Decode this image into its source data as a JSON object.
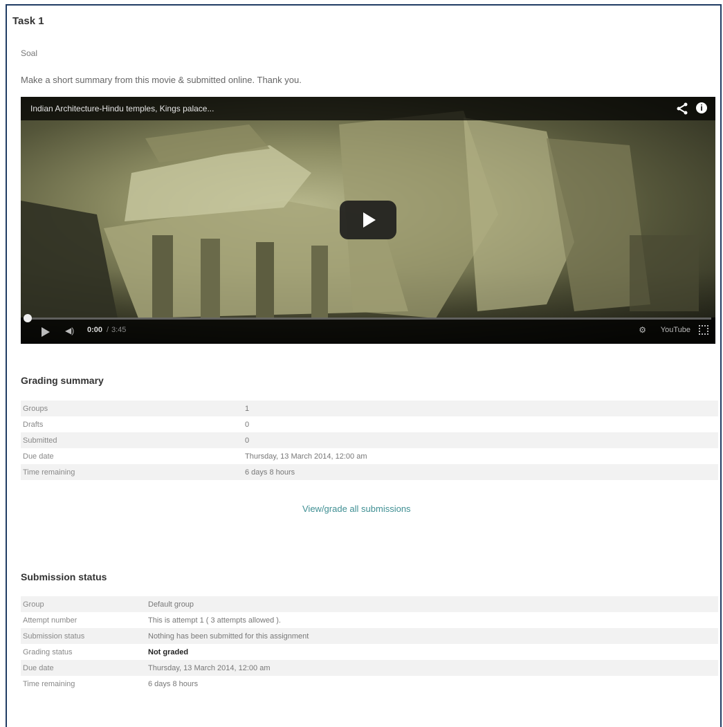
{
  "task": {
    "title": "Task 1",
    "soal": "Soal",
    "intro": "Make a short summary from this movie & submitted online. Thank you."
  },
  "video": {
    "title": "Indian Architecture-Hindu temples, Kings palace...",
    "current_time": "0:00",
    "separator": "/",
    "total_time": "3:45",
    "progress_fraction": 0.0,
    "share_icon": "share-icon",
    "info_icon": "info-icon",
    "info_glyph": "i",
    "volume_glyph": "◀)",
    "settings_glyph": "⚙",
    "youtube_label": "YouTube"
  },
  "grading_summary": {
    "title": "Grading summary",
    "rows": [
      {
        "label": "Groups",
        "value": "1"
      },
      {
        "label": "Drafts",
        "value": "0"
      },
      {
        "label": "Submitted",
        "value": "0"
      },
      {
        "label": "Due date",
        "value": "Thursday, 13 March 2014, 12:00 am"
      },
      {
        "label": "Time remaining",
        "value": "6 days 8 hours"
      }
    ],
    "link_label": "View/grade all submissions"
  },
  "submission_status": {
    "title": "Submission status",
    "rows": [
      {
        "label": "Group",
        "value": "Default group"
      },
      {
        "label": "Attempt number",
        "value": "This is attempt 1 ( 3 attempts allowed )."
      },
      {
        "label": "Submission status",
        "value": "Nothing has been submitted for this assignment"
      },
      {
        "label": "Grading status",
        "value": "Not graded"
      },
      {
        "label": "Due date",
        "value": "Thursday, 13 March 2014, 12:00 am"
      },
      {
        "label": "Time remaining",
        "value": "6 days 8 hours"
      }
    ]
  }
}
